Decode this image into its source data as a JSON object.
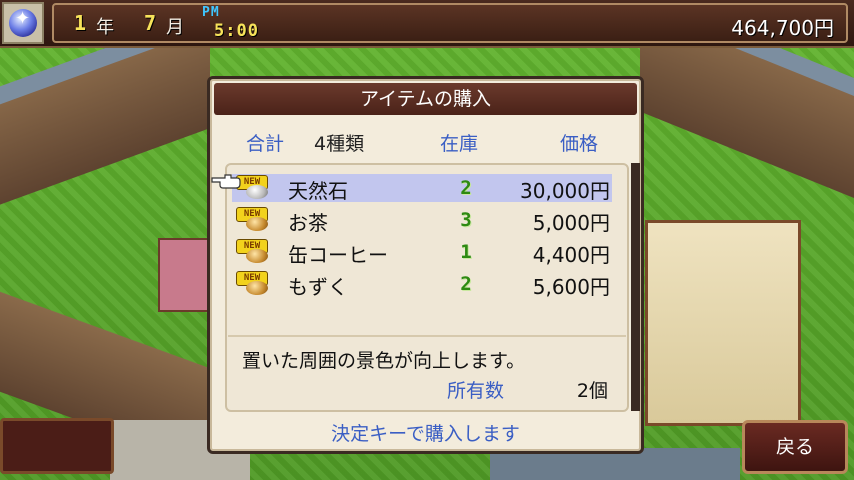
{
  "header": {
    "year_num": "1",
    "year_unit": "年",
    "month_num": "7",
    "month_unit": "月",
    "ampm": "PM",
    "time": "5:00",
    "money": "464,700円"
  },
  "dialog": {
    "title": "アイテムの購入",
    "total_label": "合計",
    "count": "4種類",
    "stock_header": "在庫",
    "price_header": "価格",
    "new_badge": "NEW",
    "items": [
      {
        "name": "天然石",
        "stock": "2",
        "price": "30,000円",
        "icon": "stone-icon"
      },
      {
        "name": "お茶",
        "stock": "3",
        "price": "5,000円",
        "icon": "bun-icon"
      },
      {
        "name": "缶コーヒー",
        "stock": "1",
        "price": "4,400円",
        "icon": "bun-icon"
      },
      {
        "name": "もずく",
        "stock": "2",
        "price": "5,600円",
        "icon": "bun-icon"
      }
    ],
    "selected_index": 0,
    "description": "置いた周囲の景色が向上します。",
    "owned_label": "所有数",
    "owned_value": "2個",
    "hint": "決定キーで購入します"
  },
  "back_label": "戻る",
  "colors": {
    "accent_blue": "#3a5ec4",
    "title_bar": "#5a2c22",
    "selection": "#c2c6ee",
    "stock_green": "#2e8a12",
    "grass": "#5aa32a"
  }
}
